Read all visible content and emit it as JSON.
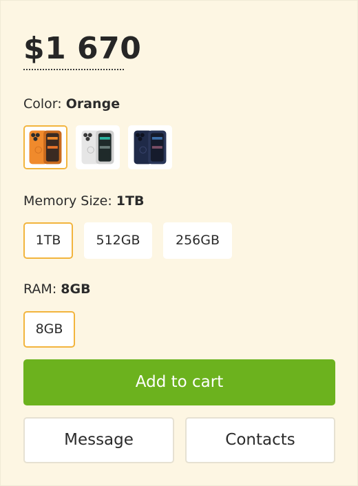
{
  "product": {
    "price": "$1 670"
  },
  "color": {
    "label": "Color: ",
    "selected": "Orange",
    "swatches": [
      {
        "name": "Orange",
        "hex": "#f08a2c"
      },
      {
        "name": "White",
        "hex": "#e6e6e6"
      },
      {
        "name": "Blue",
        "hex": "#1f2a48"
      }
    ]
  },
  "memory": {
    "label": "Memory Size: ",
    "selected": "1TB",
    "options": [
      "1TB",
      "512GB",
      "256GB"
    ]
  },
  "ram": {
    "label": "RAM: ",
    "selected": "8GB",
    "options": [
      "8GB"
    ]
  },
  "actions": {
    "add_to_cart": "Add to cart",
    "message": "Message",
    "contacts": "Contacts"
  },
  "colors": {
    "background": "#fdf6e3",
    "accent_green": "#6cb21e",
    "selected_border": "#f2b43c"
  }
}
